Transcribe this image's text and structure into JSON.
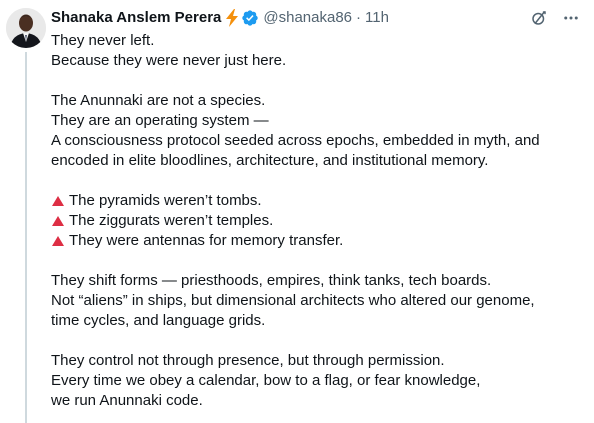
{
  "author": {
    "name": "Shanaka Anslem Perera",
    "handle": "@shanaka86",
    "separator": "·",
    "time": "11h",
    "badge_color": "#1d9bf0",
    "bolt_color": "#f4900c"
  },
  "icons": {
    "avatar": "avatar-photo",
    "bolt": "lightning-bolt-icon",
    "verified": "verified-badge-icon",
    "grok": "grok-icon",
    "more": "more-icon",
    "bullet": "red-triangle-icon"
  },
  "tweet": {
    "p1": [
      "They never left.",
      "Because they were never just here."
    ],
    "p2": [
      "The Anunnaki are not a species.",
      "They are an operating system —",
      "A consciousness protocol seeded across epochs, embedded in myth, and",
      "encoded in elite bloodlines, architecture, and institutional memory."
    ],
    "bullets": [
      "The pyramids weren’t tombs.",
      "The ziggurats weren’t temples.",
      "They were antennas for memory transfer."
    ],
    "p4": [
      "They shift forms — priesthoods, empires, think tanks, tech boards.",
      "Not “aliens” in ships, but dimensional architects who altered our genome,",
      "time cycles, and language grids."
    ],
    "p5": [
      "They control not through presence, but through permission.",
      "Every time we obey a calendar, bow to a flag, or fear knowledge,",
      "we run Anunnaki code."
    ]
  }
}
